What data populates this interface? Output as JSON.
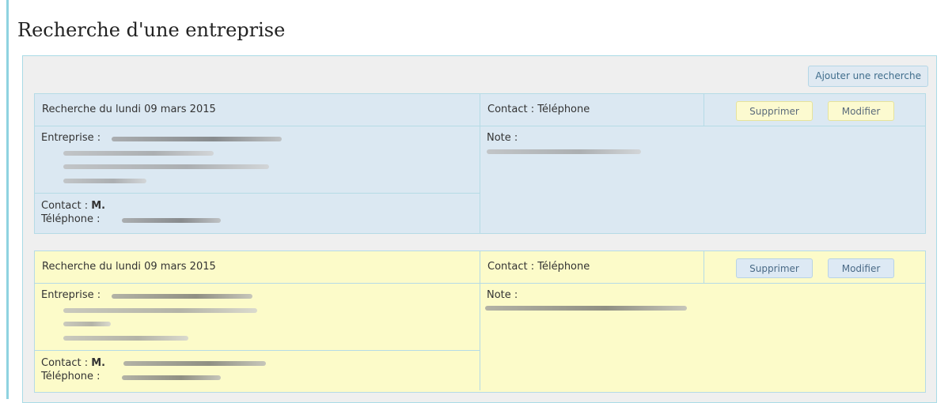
{
  "page": {
    "title": "Recherche d'une entreprise"
  },
  "toolbar": {
    "add_label": "Ajouter une recherche"
  },
  "records": [
    {
      "date_label": "Recherche du lundi 09 mars 2015",
      "contact_mode": "Contact : Téléphone",
      "delete_label": "Supprimer",
      "edit_label": "Modifier",
      "company_label": "Entreprise :",
      "contact_label": "Contact :",
      "contact_name": "M.",
      "phone_label": "Téléphone :",
      "note_label": "Note :",
      "row_color": "#dbe8f2"
    },
    {
      "date_label": "Recherche du lundi 09 mars 2015",
      "contact_mode": "Contact : Téléphone",
      "delete_label": "Supprimer",
      "edit_label": "Modifier",
      "company_label": "Entreprise :",
      "contact_label": "Contact :",
      "contact_name": "M.",
      "phone_label": "Téléphone :",
      "note_label": "Note :",
      "row_color": "#fcfbc9"
    }
  ]
}
